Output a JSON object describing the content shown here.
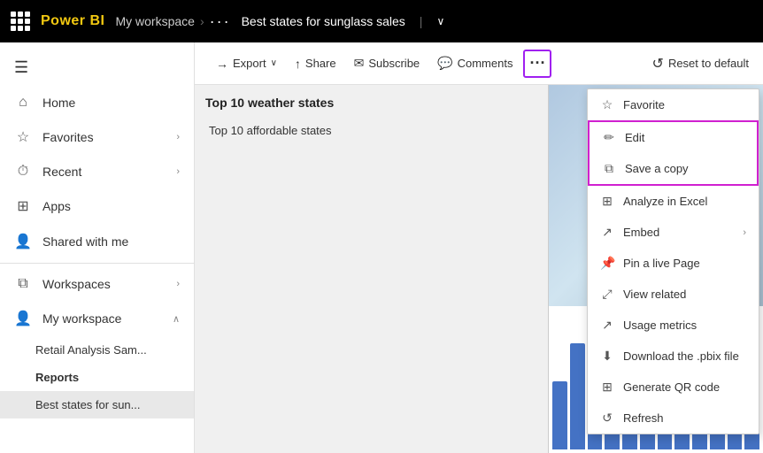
{
  "topbar": {
    "brand": "Power BI",
    "workspace": "My workspace",
    "dots": "···",
    "report_title": "Best states for sunglass sales",
    "pipe": "|",
    "chevron": "∨"
  },
  "toolbar": {
    "export_label": "Export",
    "share_label": "Share",
    "subscribe_label": "Subscribe",
    "comments_label": "Comments",
    "more_label": "···",
    "reset_label": "Reset to default"
  },
  "sidebar": {
    "hamburger": "☰",
    "items": [
      {
        "id": "home",
        "label": "Home",
        "icon": "⌂"
      },
      {
        "id": "favorites",
        "label": "Favorites",
        "icon": "☆",
        "chevron": "›"
      },
      {
        "id": "recent",
        "label": "Recent",
        "icon": "🕐",
        "chevron": "›"
      },
      {
        "id": "apps",
        "label": "Apps",
        "icon": "⊞"
      },
      {
        "id": "shared",
        "label": "Shared with me",
        "icon": "👤"
      },
      {
        "id": "workspaces",
        "label": "Workspaces",
        "icon": "⧉",
        "chevron": "›"
      },
      {
        "id": "my-workspace",
        "label": "My workspace",
        "icon": "👤",
        "chevron": "∧"
      }
    ],
    "sub_items": [
      {
        "id": "retail",
        "label": "Retail Analysis Sam..."
      },
      {
        "id": "reports",
        "label": "Reports",
        "bold": true
      },
      {
        "id": "best-states",
        "label": "Best states for sun...",
        "selected": true
      }
    ]
  },
  "pages": [
    {
      "id": "top10-weather",
      "label": "Top 10 weather states",
      "active": true
    },
    {
      "id": "top10-affordable",
      "label": "Top 10 affordable states"
    }
  ],
  "context_menu": {
    "items": [
      {
        "id": "favorite",
        "icon": "☆",
        "label": "Favorite",
        "arrow": ""
      },
      {
        "id": "edit",
        "icon": "✏",
        "label": "Edit",
        "arrow": "",
        "highlight": true
      },
      {
        "id": "save-copy",
        "icon": "⧉",
        "label": "Save a copy",
        "arrow": "",
        "highlight": true
      },
      {
        "id": "analyze",
        "icon": "⊞",
        "label": "Analyze in Excel",
        "arrow": ""
      },
      {
        "id": "embed",
        "icon": "↗",
        "label": "Embed",
        "arrow": "›"
      },
      {
        "id": "pin-live",
        "icon": "📌",
        "label": "Pin a live Page",
        "arrow": ""
      },
      {
        "id": "view-related",
        "icon": "⤢",
        "label": "View related",
        "arrow": ""
      },
      {
        "id": "usage-metrics",
        "icon": "↗",
        "label": "Usage metrics",
        "arrow": ""
      },
      {
        "id": "download",
        "icon": "⬇",
        "label": "Download the .pbix file",
        "arrow": ""
      },
      {
        "id": "qr-code",
        "icon": "⊞",
        "label": "Generate QR code",
        "arrow": ""
      },
      {
        "id": "refresh",
        "icon": "↺",
        "label": "Refresh",
        "arrow": ""
      }
    ]
  },
  "bars": [
    45,
    70,
    55,
    80,
    65,
    90,
    50,
    75,
    60,
    85,
    40,
    68
  ]
}
